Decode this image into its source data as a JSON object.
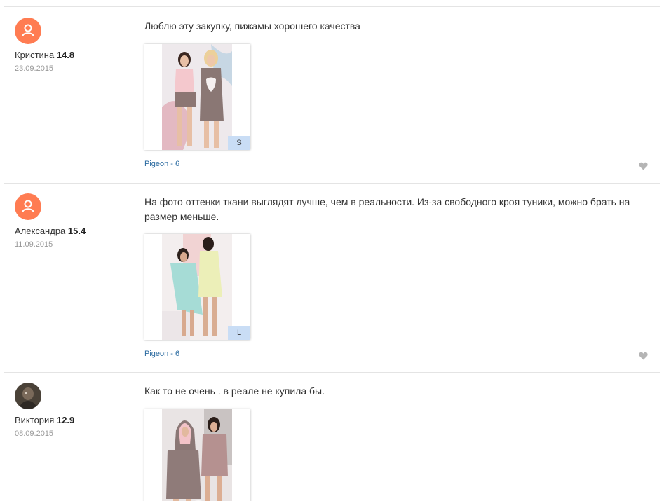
{
  "reviews": [
    {
      "author": "Кристина",
      "rating": "14.8",
      "date": "23.09.2015",
      "avatar": "user-icon",
      "text": "Люблю эту закупку, пижамы хорошего качества",
      "size": "S",
      "product": "Pigeon - 6"
    },
    {
      "author": "Александра",
      "rating": "15.4",
      "date": "11.09.2015",
      "avatar": "user-icon",
      "text": "На фото оттенки ткани выглядят лучше, чем в реальности. Из-за свободного кроя туники, можно брать на размер меньше.",
      "size": "L",
      "product": "Pigeon - 6"
    },
    {
      "author": "Виктория",
      "rating": "12.9",
      "date": "08.09.2015",
      "avatar": "user-photo",
      "text": "Как то не очень . в реале не купила бы.",
      "size": "",
      "product": ""
    }
  ],
  "colors": {
    "avatar_bg": "#ff7c52",
    "link": "#2a6aa0",
    "badge_bg": "#c9ddf5",
    "like_icon": "#b5b5b5",
    "divider": "#e4e4e4"
  }
}
